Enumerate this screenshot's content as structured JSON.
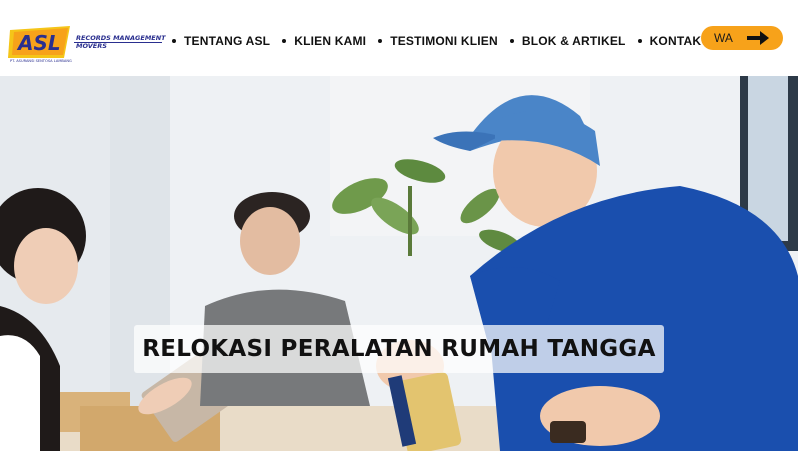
{
  "brand": {
    "logo_text": "ASL",
    "tagline_line1": "RECORDS MANAGEMENT",
    "tagline_line2": "MOVERS",
    "company": "PT. ASURANSI SENTOSA LAMBANG",
    "colors": {
      "orange": "#f7a21a",
      "navy": "#2a2f8f",
      "yellow": "#f5c518"
    }
  },
  "nav": {
    "items": [
      {
        "label": "TENTANG ASL"
      },
      {
        "label": "KLIEN KAMI"
      },
      {
        "label": "TESTIMONI KLIEN"
      },
      {
        "label": "BLOK & ARTIKEL"
      },
      {
        "label": "KONTAK KAMI"
      }
    ]
  },
  "cta": {
    "label": "WA",
    "icon": "arrow-right-icon"
  },
  "hero": {
    "title": "RELOKASI PERALATAN RUMAH TANGGA",
    "image_icon": "movers-photo"
  }
}
